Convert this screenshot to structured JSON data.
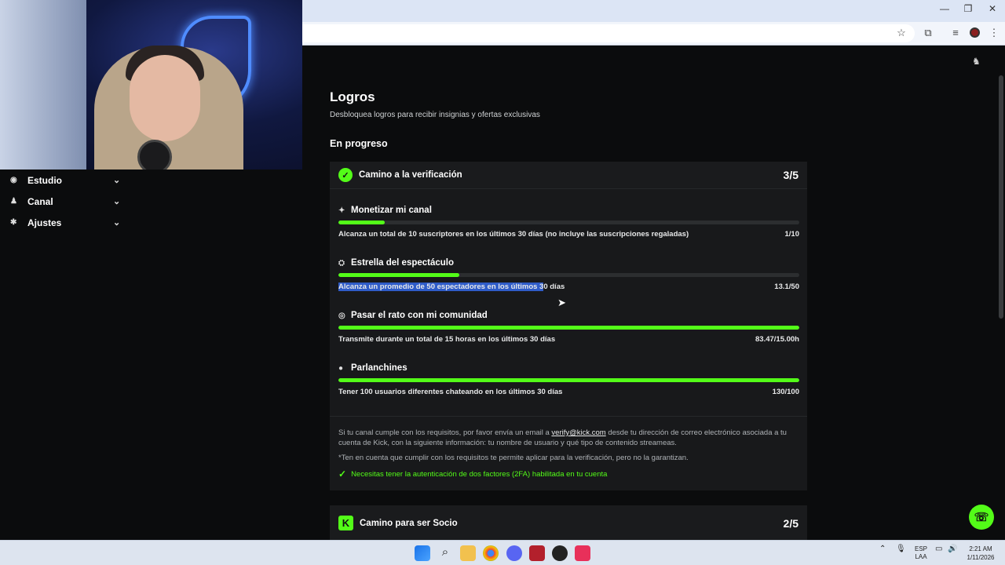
{
  "browser": {
    "min_icon": "minimize-icon",
    "max_icon": "restore-icon",
    "close_icon": "close-icon",
    "toolbar_icons": [
      "star-icon",
      "tab-search-icon",
      "media-icon",
      "profile-avatar",
      "menu-icon"
    ]
  },
  "sidebar": {
    "items": [
      {
        "label": "Estudio",
        "icon": "studio-icon"
      },
      {
        "label": "Canal",
        "icon": "channel-icon"
      },
      {
        "label": "Ajustes",
        "icon": "gear-icon"
      }
    ]
  },
  "page": {
    "title": "Logros",
    "subtitle": "Desbloquea logros para recibir insignias y ofertas exclusivas",
    "section": "En progreso"
  },
  "card1": {
    "title": "Camino a la verificación",
    "count": "3/5",
    "tasks": [
      {
        "title": "Monetizar mi canal",
        "desc": "Alcanza un total de 10 suscriptores en los últimos 30 días (no incluye las suscripciones regaladas)",
        "value": "1/10",
        "progress": 0.1
      },
      {
        "title": "Estrella del espectáculo",
        "desc_selected": "Alcanza un promedio de 50 espectadores en los últimos 3",
        "desc_rest": "0 días",
        "value": "13.1/50",
        "progress": 0.262
      },
      {
        "title": "Pasar el rato con mi comunidad",
        "desc": "Transmite durante un total de 15 horas en los últimos 30 días",
        "value": "83.47/15.00h",
        "progress": 1.0
      },
      {
        "title": "Parlanchines",
        "desc": "Tener 100 usuarios diferentes chateando en los últimos 30 días",
        "value": "130/100",
        "progress": 1.0
      }
    ],
    "note_part1": "Si tu canal cumple con los requisitos, por favor envía un email a ",
    "note_email": "verify@kick.com",
    "note_part2": " desde tu dirección de correo electrónico asociada a tu cuenta de Kick, con la siguiente información: tu nombre de usuario y qué tipo de contenido streameas.",
    "disclaimer": "*Ten en cuenta que cumplir con los requisitos te permite aplicar para la verificación, pero no la garantizan.",
    "twofa": "Necesitas tener la autenticación de dos factores (2FA) habilitada en tu cuenta"
  },
  "card2": {
    "title": "Camino para ser Socio",
    "count": "2/5"
  },
  "taskbar": {
    "lang_top": "ESP",
    "lang_bottom": "LAA",
    "time": "2:21 AM",
    "date": "1/11/2026"
  },
  "colors": {
    "accent": "#53fc18",
    "bg": "#0b0c0d",
    "card": "#18191b"
  }
}
